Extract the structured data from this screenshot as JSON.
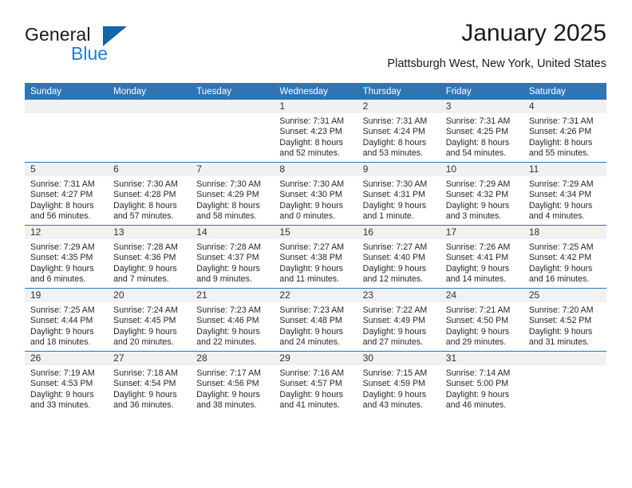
{
  "brand": {
    "word_general": "General",
    "word_blue": "Blue",
    "triangle_color": "#1565a8",
    "blue_color": "#1f7fd1"
  },
  "header": {
    "month_title": "January 2025",
    "location": "Plattsburgh West, New York, United States",
    "header_bg": "#2e75b6",
    "daynum_band_bg": "#f1f1f1"
  },
  "weekday_headers": [
    "Sunday",
    "Monday",
    "Tuesday",
    "Wednesday",
    "Thursday",
    "Friday",
    "Saturday"
  ],
  "weeks": [
    [
      {
        "day": "",
        "sunrise": "",
        "sunset": "",
        "daylight_line1": "",
        "daylight_line2": ""
      },
      {
        "day": "",
        "sunrise": "",
        "sunset": "",
        "daylight_line1": "",
        "daylight_line2": ""
      },
      {
        "day": "",
        "sunrise": "",
        "sunset": "",
        "daylight_line1": "",
        "daylight_line2": ""
      },
      {
        "day": "1",
        "sunrise": "Sunrise: 7:31 AM",
        "sunset": "Sunset: 4:23 PM",
        "daylight_line1": "Daylight: 8 hours",
        "daylight_line2": "and 52 minutes."
      },
      {
        "day": "2",
        "sunrise": "Sunrise: 7:31 AM",
        "sunset": "Sunset: 4:24 PM",
        "daylight_line1": "Daylight: 8 hours",
        "daylight_line2": "and 53 minutes."
      },
      {
        "day": "3",
        "sunrise": "Sunrise: 7:31 AM",
        "sunset": "Sunset: 4:25 PM",
        "daylight_line1": "Daylight: 8 hours",
        "daylight_line2": "and 54 minutes."
      },
      {
        "day": "4",
        "sunrise": "Sunrise: 7:31 AM",
        "sunset": "Sunset: 4:26 PM",
        "daylight_line1": "Daylight: 8 hours",
        "daylight_line2": "and 55 minutes."
      }
    ],
    [
      {
        "day": "5",
        "sunrise": "Sunrise: 7:31 AM",
        "sunset": "Sunset: 4:27 PM",
        "daylight_line1": "Daylight: 8 hours",
        "daylight_line2": "and 56 minutes."
      },
      {
        "day": "6",
        "sunrise": "Sunrise: 7:30 AM",
        "sunset": "Sunset: 4:28 PM",
        "daylight_line1": "Daylight: 8 hours",
        "daylight_line2": "and 57 minutes."
      },
      {
        "day": "7",
        "sunrise": "Sunrise: 7:30 AM",
        "sunset": "Sunset: 4:29 PM",
        "daylight_line1": "Daylight: 8 hours",
        "daylight_line2": "and 58 minutes."
      },
      {
        "day": "8",
        "sunrise": "Sunrise: 7:30 AM",
        "sunset": "Sunset: 4:30 PM",
        "daylight_line1": "Daylight: 9 hours",
        "daylight_line2": "and 0 minutes."
      },
      {
        "day": "9",
        "sunrise": "Sunrise: 7:30 AM",
        "sunset": "Sunset: 4:31 PM",
        "daylight_line1": "Daylight: 9 hours",
        "daylight_line2": "and 1 minute."
      },
      {
        "day": "10",
        "sunrise": "Sunrise: 7:29 AM",
        "sunset": "Sunset: 4:32 PM",
        "daylight_line1": "Daylight: 9 hours",
        "daylight_line2": "and 3 minutes."
      },
      {
        "day": "11",
        "sunrise": "Sunrise: 7:29 AM",
        "sunset": "Sunset: 4:34 PM",
        "daylight_line1": "Daylight: 9 hours",
        "daylight_line2": "and 4 minutes."
      }
    ],
    [
      {
        "day": "12",
        "sunrise": "Sunrise: 7:29 AM",
        "sunset": "Sunset: 4:35 PM",
        "daylight_line1": "Daylight: 9 hours",
        "daylight_line2": "and 6 minutes."
      },
      {
        "day": "13",
        "sunrise": "Sunrise: 7:28 AM",
        "sunset": "Sunset: 4:36 PM",
        "daylight_line1": "Daylight: 9 hours",
        "daylight_line2": "and 7 minutes."
      },
      {
        "day": "14",
        "sunrise": "Sunrise: 7:28 AM",
        "sunset": "Sunset: 4:37 PM",
        "daylight_line1": "Daylight: 9 hours",
        "daylight_line2": "and 9 minutes."
      },
      {
        "day": "15",
        "sunrise": "Sunrise: 7:27 AM",
        "sunset": "Sunset: 4:38 PM",
        "daylight_line1": "Daylight: 9 hours",
        "daylight_line2": "and 11 minutes."
      },
      {
        "day": "16",
        "sunrise": "Sunrise: 7:27 AM",
        "sunset": "Sunset: 4:40 PM",
        "daylight_line1": "Daylight: 9 hours",
        "daylight_line2": "and 12 minutes."
      },
      {
        "day": "17",
        "sunrise": "Sunrise: 7:26 AM",
        "sunset": "Sunset: 4:41 PM",
        "daylight_line1": "Daylight: 9 hours",
        "daylight_line2": "and 14 minutes."
      },
      {
        "day": "18",
        "sunrise": "Sunrise: 7:25 AM",
        "sunset": "Sunset: 4:42 PM",
        "daylight_line1": "Daylight: 9 hours",
        "daylight_line2": "and 16 minutes."
      }
    ],
    [
      {
        "day": "19",
        "sunrise": "Sunrise: 7:25 AM",
        "sunset": "Sunset: 4:44 PM",
        "daylight_line1": "Daylight: 9 hours",
        "daylight_line2": "and 18 minutes."
      },
      {
        "day": "20",
        "sunrise": "Sunrise: 7:24 AM",
        "sunset": "Sunset: 4:45 PM",
        "daylight_line1": "Daylight: 9 hours",
        "daylight_line2": "and 20 minutes."
      },
      {
        "day": "21",
        "sunrise": "Sunrise: 7:23 AM",
        "sunset": "Sunset: 4:46 PM",
        "daylight_line1": "Daylight: 9 hours",
        "daylight_line2": "and 22 minutes."
      },
      {
        "day": "22",
        "sunrise": "Sunrise: 7:23 AM",
        "sunset": "Sunset: 4:48 PM",
        "daylight_line1": "Daylight: 9 hours",
        "daylight_line2": "and 24 minutes."
      },
      {
        "day": "23",
        "sunrise": "Sunrise: 7:22 AM",
        "sunset": "Sunset: 4:49 PM",
        "daylight_line1": "Daylight: 9 hours",
        "daylight_line2": "and 27 minutes."
      },
      {
        "day": "24",
        "sunrise": "Sunrise: 7:21 AM",
        "sunset": "Sunset: 4:50 PM",
        "daylight_line1": "Daylight: 9 hours",
        "daylight_line2": "and 29 minutes."
      },
      {
        "day": "25",
        "sunrise": "Sunrise: 7:20 AM",
        "sunset": "Sunset: 4:52 PM",
        "daylight_line1": "Daylight: 9 hours",
        "daylight_line2": "and 31 minutes."
      }
    ],
    [
      {
        "day": "26",
        "sunrise": "Sunrise: 7:19 AM",
        "sunset": "Sunset: 4:53 PM",
        "daylight_line1": "Daylight: 9 hours",
        "daylight_line2": "and 33 minutes."
      },
      {
        "day": "27",
        "sunrise": "Sunrise: 7:18 AM",
        "sunset": "Sunset: 4:54 PM",
        "daylight_line1": "Daylight: 9 hours",
        "daylight_line2": "and 36 minutes."
      },
      {
        "day": "28",
        "sunrise": "Sunrise: 7:17 AM",
        "sunset": "Sunset: 4:56 PM",
        "daylight_line1": "Daylight: 9 hours",
        "daylight_line2": "and 38 minutes."
      },
      {
        "day": "29",
        "sunrise": "Sunrise: 7:16 AM",
        "sunset": "Sunset: 4:57 PM",
        "daylight_line1": "Daylight: 9 hours",
        "daylight_line2": "and 41 minutes."
      },
      {
        "day": "30",
        "sunrise": "Sunrise: 7:15 AM",
        "sunset": "Sunset: 4:59 PM",
        "daylight_line1": "Daylight: 9 hours",
        "daylight_line2": "and 43 minutes."
      },
      {
        "day": "31",
        "sunrise": "Sunrise: 7:14 AM",
        "sunset": "Sunset: 5:00 PM",
        "daylight_line1": "Daylight: 9 hours",
        "daylight_line2": "and 46 minutes."
      },
      {
        "day": "",
        "sunrise": "",
        "sunset": "",
        "daylight_line1": "",
        "daylight_line2": ""
      }
    ]
  ]
}
